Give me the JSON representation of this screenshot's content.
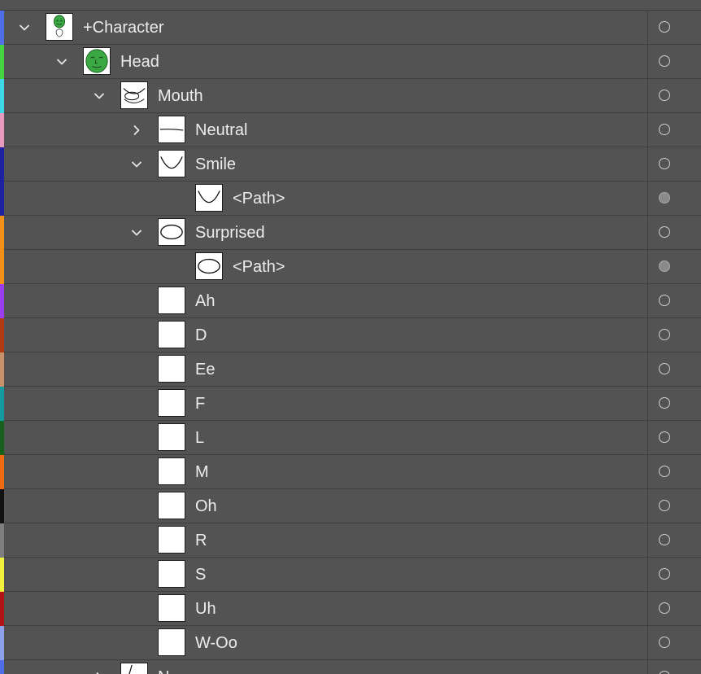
{
  "layers": [
    {
      "name": "+Character",
      "color": "#4f6ee8",
      "expanded": "down",
      "indent": 0,
      "thumb": "character",
      "target": "ring"
    },
    {
      "name": "Head",
      "color": "#44d43f",
      "expanded": "down",
      "indent": 1,
      "thumb": "head",
      "target": "ring"
    },
    {
      "name": "Mouth",
      "color": "#3fd8e8",
      "expanded": "down",
      "indent": 2,
      "thumb": "mouth",
      "target": "ring"
    },
    {
      "name": "Neutral",
      "color": "#e89abd",
      "expanded": "right",
      "indent": 3,
      "thumb": "neutral",
      "target": "ring"
    },
    {
      "name": "Smile",
      "color": "#1d22a0",
      "expanded": "down",
      "indent": 3,
      "thumb": "smile",
      "target": "ring"
    },
    {
      "name": "<Path>",
      "color": "#1d22a0",
      "expanded": "none",
      "indent": 4,
      "thumb": "smile",
      "target": "filled"
    },
    {
      "name": "Surprised",
      "color": "#f29018",
      "expanded": "down",
      "indent": 3,
      "thumb": "oval",
      "target": "ring"
    },
    {
      "name": "<Path>",
      "color": "#f29018",
      "expanded": "none",
      "indent": 4,
      "thumb": "oval",
      "target": "filled"
    },
    {
      "name": "Ah",
      "color": "#9b3ef0",
      "expanded": "none",
      "indent": 3,
      "thumb": "blank",
      "target": "ring"
    },
    {
      "name": "D",
      "color": "#b23a12",
      "expanded": "none",
      "indent": 3,
      "thumb": "blank",
      "target": "ring"
    },
    {
      "name": "Ee",
      "color": "#c99169",
      "expanded": "none",
      "indent": 3,
      "thumb": "blank",
      "target": "ring"
    },
    {
      "name": "F",
      "color": "#149aa0",
      "expanded": "none",
      "indent": 3,
      "thumb": "blank",
      "target": "ring"
    },
    {
      "name": "L",
      "color": "#17611c",
      "expanded": "none",
      "indent": 3,
      "thumb": "blank",
      "target": "ring"
    },
    {
      "name": "M",
      "color": "#f06a10",
      "expanded": "none",
      "indent": 3,
      "thumb": "blank",
      "target": "ring"
    },
    {
      "name": "Oh",
      "color": "#111111",
      "expanded": "none",
      "indent": 3,
      "thumb": "blank",
      "target": "ring"
    },
    {
      "name": "R",
      "color": "#7e7e7e",
      "expanded": "none",
      "indent": 3,
      "thumb": "blank",
      "target": "ring"
    },
    {
      "name": "S",
      "color": "#f2f23c",
      "expanded": "none",
      "indent": 3,
      "thumb": "blank",
      "target": "ring"
    },
    {
      "name": "Uh",
      "color": "#b01414",
      "expanded": "none",
      "indent": 3,
      "thumb": "blank",
      "target": "ring"
    },
    {
      "name": "W-Oo",
      "color": "#8fa0ea",
      "expanded": "none",
      "indent": 3,
      "thumb": "blank",
      "target": "ring"
    },
    {
      "name": "N",
      "color": "#4f6ee8",
      "expanded": "right",
      "indent": 2,
      "thumb": "nose",
      "target": "ring"
    }
  ]
}
